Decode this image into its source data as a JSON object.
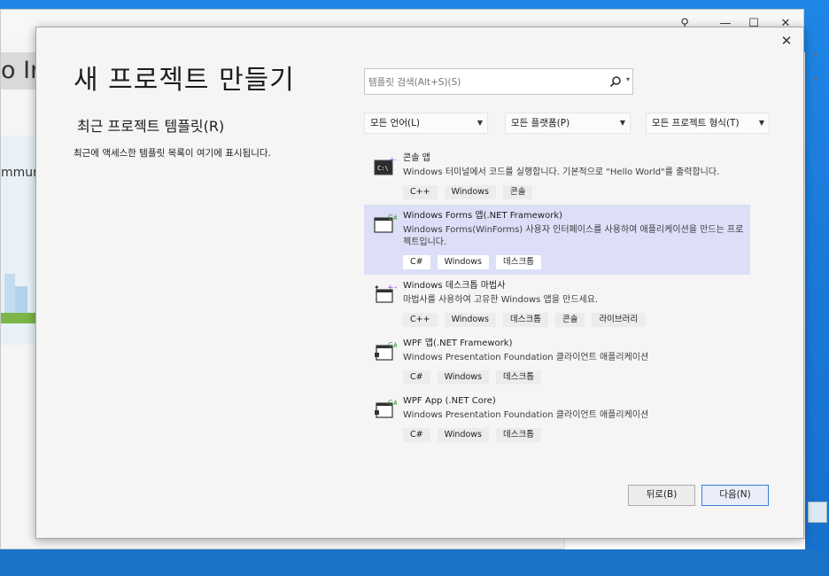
{
  "dialog": {
    "title": "새 프로젝트 만들기",
    "recent_header": "최근 프로젝트 템플릿(R)",
    "recent_note": "최근에 액세스한 템플릿 목록이 여기에 표시됩니다."
  },
  "background": {
    "left_title": "o In",
    "left_text": "mmun"
  },
  "search": {
    "placeholder": "템플릿 검색(Alt+S)(S)"
  },
  "filters": {
    "language": "모든 언어(L)",
    "platform": "모든 플랫폼(P)",
    "project_type": "모든 프로젝트 형식(T)"
  },
  "templates": [
    {
      "name": "콘솔 앱",
      "description": "Windows 터미널에서 코드를 실행합니다. 기본적으로 \"Hello World\"를 출력합니다.",
      "tags": [
        "C++",
        "Windows",
        "콘솔"
      ],
      "icon": "console-app-icon"
    },
    {
      "name": "Windows Forms 앱(.NET Framework)",
      "description": "Windows Forms(WinForms) 사용자 인터페이스를 사용하여 애플리케이션을 만드는 프로젝트입니다.",
      "tags": [
        "C#",
        "Windows",
        "데스크톱"
      ],
      "icon": "winforms-icon",
      "selected": true
    },
    {
      "name": "Windows 데스크톱 마법사",
      "description": "마법사를 사용하여 고유한 Windows 앱을 만드세요.",
      "tags": [
        "C++",
        "Windows",
        "데스크톱",
        "콘솔",
        "라이브러리"
      ],
      "icon": "desktop-wizard-icon"
    },
    {
      "name": "WPF 앱(.NET Framework)",
      "description": "Windows Presentation Foundation 클라이언트 애플리케이션",
      "tags": [
        "C#",
        "Windows",
        "데스크톱"
      ],
      "icon": "wpf-icon"
    },
    {
      "name": "WPF App (.NET Core)",
      "description": "Windows Presentation Foundation 클라이언트 애플리케이션",
      "tags": [
        "C#",
        "Windows",
        "데스크톱"
      ],
      "icon": "wpf-core-icon"
    }
  ],
  "buttons": {
    "back": "뒤로(B)",
    "next": "다음(N)"
  },
  "colors": {
    "selected_bg": "#dcdff7",
    "primary_border": "#3a7dd6",
    "desktop_blue": "#1b7bdb"
  }
}
